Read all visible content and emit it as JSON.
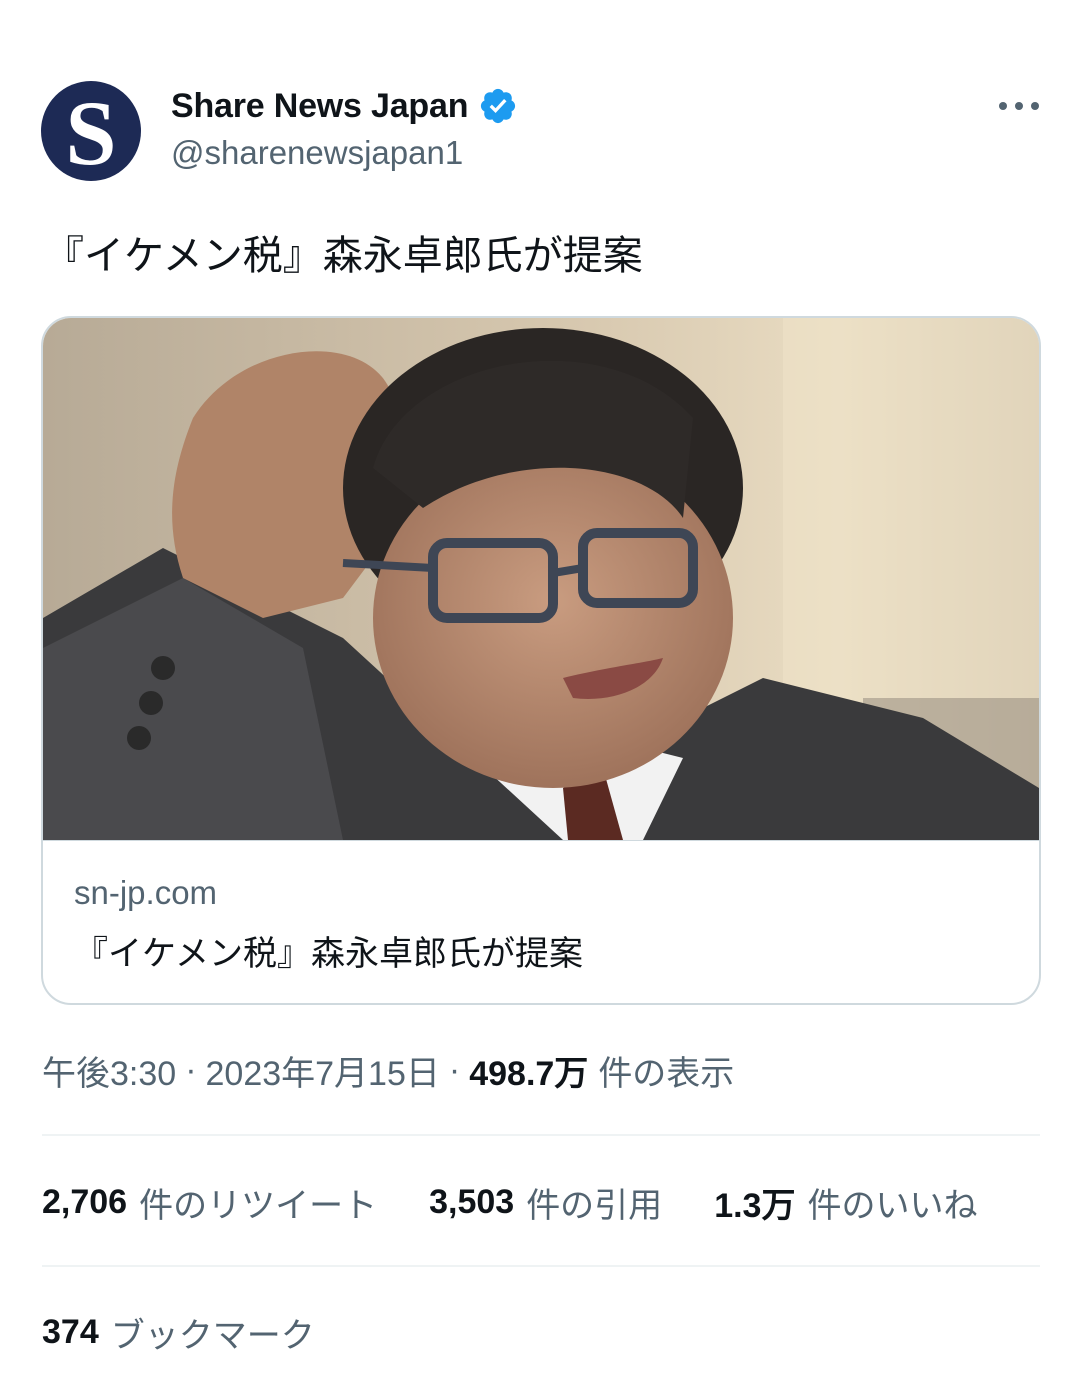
{
  "tweet": {
    "author": {
      "display_name": "Share News Japan",
      "handle": "@sharenewsjapan1",
      "avatar_letter": "S",
      "verified": true,
      "verified_color": "#1d9bf0"
    },
    "text": "『イケメン税』森永卓郎氏が提案",
    "icons": {
      "more": "more-horizontal-icon",
      "verified": "verified-badge-icon"
    }
  },
  "card": {
    "image_alt": "photo",
    "domain": "sn-jp.com",
    "title": "『イケメン税』森永卓郎氏が提案"
  },
  "meta": {
    "time": "午後3:30",
    "separator": "·",
    "date": "2023年7月15日",
    "views_count": "498.7万",
    "views_label": "件の表示"
  },
  "stats": {
    "retweets_count": "2,706",
    "retweets_label": "件のリツイート",
    "quotes_count": "3,503",
    "quotes_label": "件の引用",
    "likes_count": "1.3万",
    "likes_label": "件のいいね"
  },
  "bookmarks": {
    "count": "374",
    "label": "ブックマーク"
  },
  "colors": {
    "text_primary": "#0f1419",
    "text_secondary": "#536471",
    "border": "#cfd9de",
    "avatar_bg": "#1d2a55"
  }
}
